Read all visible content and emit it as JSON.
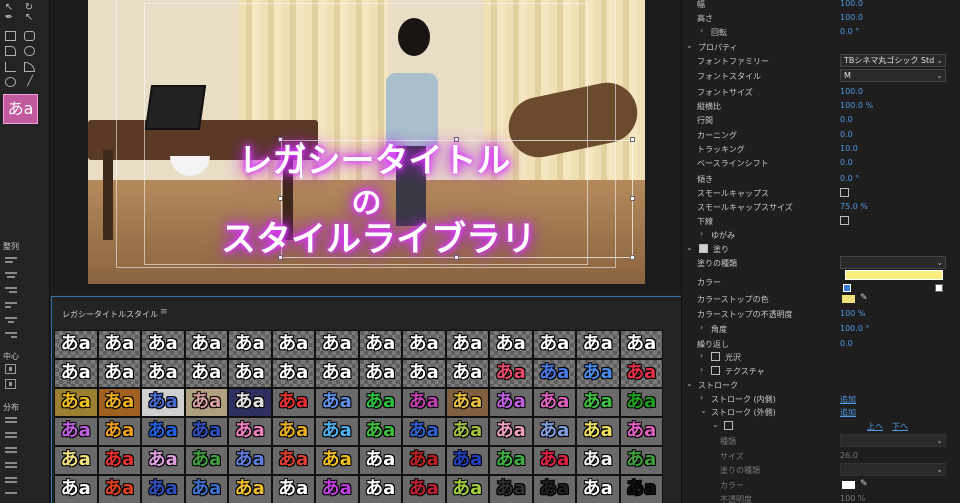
{
  "tools": {
    "style_swatch": "あa",
    "align_label": "整列",
    "center_label": "中心",
    "distribute_label": "分布"
  },
  "canvas": {
    "title_line1": "レガシータイトル",
    "title_line2": "の",
    "title_line3": "スタイルライブラリ"
  },
  "library": {
    "title": "レガシータイトルスタイル",
    "menu_icon": "≡",
    "sample": "あa",
    "rows": [
      [
        {
          "fg": "#ffffff",
          "bg": "#6a6a6a",
          "checker": true
        },
        {
          "fg": "#ffffff",
          "bg": "#6a6a6a",
          "checker": true
        },
        {
          "fg": "#ffffff",
          "bg": "#6a6a6a",
          "checker": true
        },
        {
          "fg": "#ffffff",
          "bg": "#6a6a6a",
          "checker": true
        },
        {
          "fg": "#ffffff",
          "bg": "#6a6a6a",
          "checker": true
        },
        {
          "fg": "#ffffff",
          "bg": "#6a6a6a",
          "checker": true
        },
        {
          "fg": "#ffffff",
          "bg": "#6a6a6a",
          "checker": true
        },
        {
          "fg": "#ffffff",
          "bg": "#6a6a6a",
          "checker": true
        },
        {
          "fg": "#ffffff",
          "bg": "#6a6a6a",
          "checker": true
        },
        {
          "fg": "#ffffff",
          "bg": "#6a6a6a",
          "checker": true
        },
        {
          "fg": "#ffffff",
          "bg": "#6a6a6a",
          "checker": true
        },
        {
          "fg": "#ffffff",
          "bg": "#6a6a6a",
          "checker": true
        },
        {
          "fg": "#ffffff",
          "bg": "#6a6a6a",
          "checker": true
        },
        {
          "fg": "#ffffff",
          "bg": "#6a6a6a",
          "checker": true
        }
      ],
      [
        {
          "fg": "#ffffff",
          "bg": "#5a5a5a",
          "checker": true
        },
        {
          "fg": "#ffffff",
          "bg": "#5a5a5a",
          "checker": true
        },
        {
          "fg": "#ffffff",
          "bg": "#5a5a5a",
          "checker": true
        },
        {
          "fg": "#ffffff",
          "bg": "#5a5a5a",
          "checker": true
        },
        {
          "fg": "#ffffff",
          "bg": "#5a5a5a",
          "checker": true
        },
        {
          "fg": "#ffffff",
          "bg": "#5a5a5a",
          "checker": true
        },
        {
          "fg": "#ffffff",
          "bg": "#5a5a5a",
          "checker": true
        },
        {
          "fg": "#ffffff",
          "bg": "#5a5a5a",
          "checker": true
        },
        {
          "fg": "#ffffff",
          "bg": "#5a5a5a",
          "checker": true
        },
        {
          "fg": "#ffffff",
          "bg": "#5a5a5a",
          "checker": true
        },
        {
          "fg": "#e84a6a",
          "bg": "#5a5a5a",
          "checker": true
        },
        {
          "fg": "#4a7ae8",
          "bg": "#5a5a5a",
          "checker": true
        },
        {
          "fg": "#4a8ae8",
          "bg": "#5a5a5a",
          "checker": true
        },
        {
          "fg": "#e8304a",
          "bg": "#5a5a5a",
          "checker": true
        }
      ],
      [
        {
          "fg": "#f0c020",
          "bg": "#9a8030",
          "checker": false
        },
        {
          "fg": "#f0b020",
          "bg": "#a06020",
          "checker": false
        },
        {
          "fg": "#4a6ad0",
          "bg": "#d0d0d0",
          "checker": false
        },
        {
          "fg": "#d8a0a0",
          "bg": "#b0a080",
          "checker": false
        },
        {
          "fg": "#e0e0e0",
          "bg": "#303060",
          "checker": false
        },
        {
          "fg": "#e83030",
          "bg": "#6a6a6a",
          "checker": false
        },
        {
          "fg": "#6090e8",
          "bg": "#6a6a6a",
          "checker": false
        },
        {
          "fg": "#30c040",
          "bg": "#6a6a6a",
          "checker": false
        },
        {
          "fg": "#c040b0",
          "bg": "#6a6a6a",
          "checker": false
        },
        {
          "fg": "#e8c040",
          "bg": "#806040",
          "checker": false
        },
        {
          "fg": "#c060e0",
          "bg": "#6a6a6a",
          "checker": false
        },
        {
          "fg": "#e060c0",
          "bg": "#6a6a6a",
          "checker": false
        },
        {
          "fg": "#40c040",
          "bg": "#6a6a6a",
          "checker": false
        },
        {
          "fg": "#20a020",
          "bg": "#6a6a6a",
          "checker": false
        }
      ],
      [
        {
          "fg": "#c060e0",
          "bg": "#6a6a6a",
          "checker": false
        },
        {
          "fg": "#f0a020",
          "bg": "#6a6a6a",
          "checker": false
        },
        {
          "fg": "#2060e0",
          "bg": "#6a6a6a",
          "checker": false
        },
        {
          "fg": "#3050c0",
          "bg": "#6a6a6a",
          "checker": false
        },
        {
          "fg": "#f080c0",
          "bg": "#6a6a6a",
          "checker": false
        },
        {
          "fg": "#e8b020",
          "bg": "#6a6a6a",
          "checker": false
        },
        {
          "fg": "#50b0f0",
          "bg": "#6a6a6a",
          "checker": false
        },
        {
          "fg": "#40c040",
          "bg": "#6a6a6a",
          "checker": false
        },
        {
          "fg": "#3060d0",
          "bg": "#6a6a6a",
          "checker": false
        },
        {
          "fg": "#a0c040",
          "bg": "#6a6a6a",
          "checker": false
        },
        {
          "fg": "#f0a0c0",
          "bg": "#6a6a6a",
          "checker": false
        },
        {
          "fg": "#80a0e0",
          "bg": "#6a6a6a",
          "checker": false
        },
        {
          "fg": "#f0e060",
          "bg": "#6a6a6a",
          "checker": false
        },
        {
          "fg": "#e060c0",
          "bg": "#6a6a6a",
          "checker": false
        }
      ],
      [
        {
          "fg": "#f0e080",
          "bg": "#6a6a6a",
          "checker": false
        },
        {
          "fg": "#e83030",
          "bg": "#6a6a6a",
          "checker": false
        },
        {
          "fg": "#e0a0e0",
          "bg": "#6a6a6a",
          "checker": false
        },
        {
          "fg": "#40a040",
          "bg": "#6a6a6a",
          "checker": false
        },
        {
          "fg": "#6080e0",
          "bg": "#6a6a6a",
          "checker": false
        },
        {
          "fg": "#e04030",
          "bg": "#6a6a6a",
          "checker": false
        },
        {
          "fg": "#f0c020",
          "bg": "#6a6a6a",
          "checker": false
        },
        {
          "fg": "#ffffff",
          "bg": "#6a6a6a",
          "checker": false
        },
        {
          "fg": "#c02020",
          "bg": "#6a6a6a",
          "checker": false
        },
        {
          "fg": "#2040c0",
          "bg": "#6a6a6a",
          "checker": false
        },
        {
          "fg": "#40b040",
          "bg": "#6a6a6a",
          "checker": false
        },
        {
          "fg": "#e02040",
          "bg": "#6a6a6a",
          "checker": false
        },
        {
          "fg": "#f0f0f0",
          "bg": "#6a6a6a",
          "checker": false
        },
        {
          "fg": "#40a040",
          "bg": "#6a6a6a",
          "checker": false
        }
      ],
      [
        {
          "fg": "#ffffff",
          "bg": "#6a6a6a",
          "checker": false
        },
        {
          "fg": "#e04020",
          "bg": "#6a6a6a",
          "checker": false
        },
        {
          "fg": "#3050c0",
          "bg": "#6a6a6a",
          "checker": false
        },
        {
          "fg": "#4070d0",
          "bg": "#6a6a6a",
          "checker": false
        },
        {
          "fg": "#f0c030",
          "bg": "#6a6a6a",
          "checker": false
        },
        {
          "fg": "#ffffff",
          "bg": "#6a6a6a",
          "checker": false
        },
        {
          "fg": "#c040e0",
          "bg": "#6a6a6a",
          "checker": false
        },
        {
          "fg": "#ffffff",
          "bg": "#6a6a6a",
          "checker": false
        },
        {
          "fg": "#c02030",
          "bg": "#6a6a6a",
          "checker": false
        },
        {
          "fg": "#a0d040",
          "bg": "#6a6a6a",
          "checker": false
        },
        {
          "fg": "#303030",
          "bg": "#6a6a6a",
          "checker": false
        },
        {
          "fg": "#202020",
          "bg": "#6a6a6a",
          "checker": false
        },
        {
          "fg": "#ffffff",
          "bg": "#6a6a6a",
          "checker": false
        },
        {
          "fg": "#101010",
          "bg": "#6a6a6a",
          "checker": false
        }
      ]
    ]
  },
  "props": {
    "width_label": "幅",
    "width_value": "100.0",
    "height_label": "高さ",
    "height_value": "100.0",
    "rotation_label": "回転",
    "rotation_value": "0.0 °",
    "properties_label": "プロパティ",
    "font_family_label": "フォントファミリー",
    "font_family_value": "TBシネマ丸ゴシック Std",
    "font_style_label": "フォントスタイル",
    "font_style_value": "M",
    "font_size_label": "フォントサイズ",
    "font_size_value": "100.0",
    "aspect_label": "縦横比",
    "aspect_value": "100.0 %",
    "leading_label": "行間",
    "leading_value": "0.0",
    "kerning_label": "カーニング",
    "kerning_value": "0.0",
    "tracking_label": "トラッキング",
    "tracking_value": "10.0",
    "baseline_label": "ベースラインシフト",
    "baseline_value": "0.0",
    "slant_label": "傾き",
    "slant_value": "0.0 °",
    "smallcaps_label": "スモールキャップス",
    "smallcaps_size_label": "スモールキャップスサイズ",
    "smallcaps_size_value": "75.0 %",
    "underline_label": "下線",
    "distort_label": "ゆがみ",
    "fill_label": "塗り",
    "fill_type_label": "塗りの種類",
    "color_label": "カラー",
    "color_stop_label": "カラーストップの色",
    "color_stop_opacity_label": "カラーストップの不透明度",
    "color_stop_opacity_value": "100 %",
    "angle_label": "角度",
    "angle_value": "100.0 °",
    "repeat_label": "繰り返し",
    "repeat_value": "0.0",
    "sheen_label": "光沢",
    "texture_label": "テクスチャ",
    "stroke_label": "ストローク",
    "inner_stroke_label": "ストローク (内側)",
    "inner_stroke_add": "追加",
    "outer_stroke_label": "ストローク (外側)",
    "outer_stroke_add": "追加",
    "up_label": "上へ",
    "down_label": "下へ",
    "type_label": "種類",
    "size_label": "サイズ",
    "size_value": "26.0",
    "fill_type2_label": "塗りの種類",
    "color2_label": "カラー",
    "opacity_label": "不透明度",
    "opacity_value": "100 %",
    "gradient_color": "#f7ec80"
  }
}
